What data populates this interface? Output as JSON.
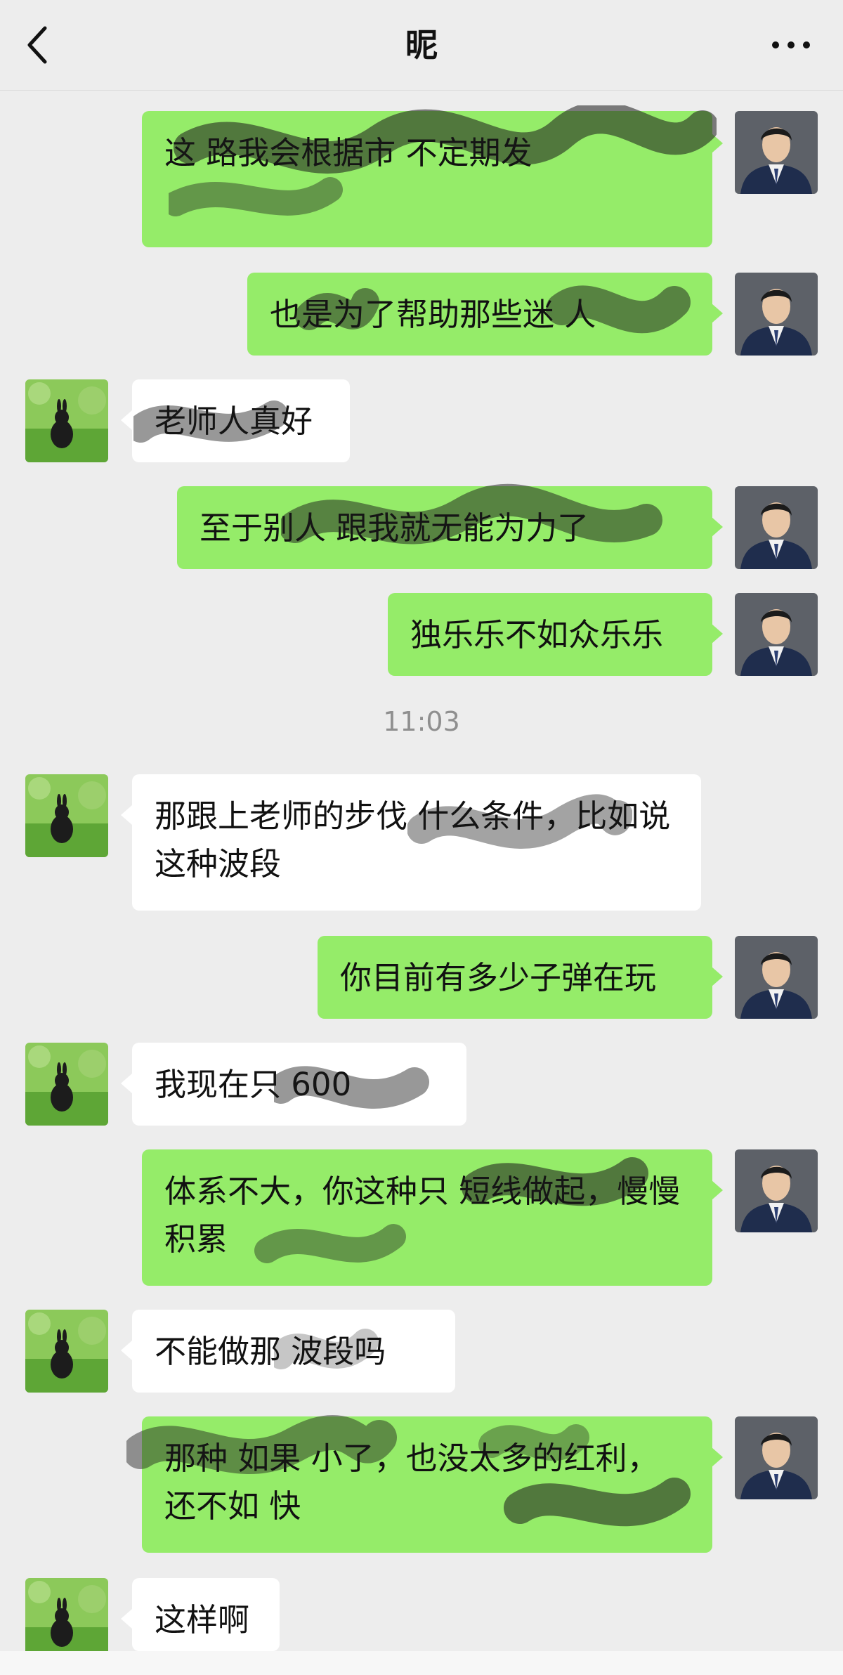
{
  "header": {
    "title": "昵"
  },
  "timestamp": "11:03",
  "messages": [
    {
      "side": "right",
      "text": "这 路我会根据市 不定期发"
    },
    {
      "side": "right",
      "text": "也是为了帮助那些迷 人"
    },
    {
      "side": "left",
      "text": "老师人真好"
    },
    {
      "side": "right",
      "text": "至于别人 跟我就无能为力了"
    },
    {
      "side": "right",
      "text": "独乐乐不如众乐乐"
    },
    {
      "side": "left",
      "text": "那跟上老师的步伐 什么条件，比如说这种波段"
    },
    {
      "side": "right",
      "text": "你目前有多少子弹在玩"
    },
    {
      "side": "left",
      "text": "我现在只 600"
    },
    {
      "side": "right",
      "text": "体系不大，你这种只 短线做起，慢慢积累"
    },
    {
      "side": "left",
      "text": "不能做那 波段吗"
    },
    {
      "side": "right",
      "text": "那种 如果 小了，也没太多的红利，还不如 快"
    },
    {
      "side": "left",
      "text": "这样啊"
    }
  ],
  "colors": {
    "green_bubble": "#95ec69",
    "white_bubble": "#ffffff",
    "background": "#ededed"
  }
}
